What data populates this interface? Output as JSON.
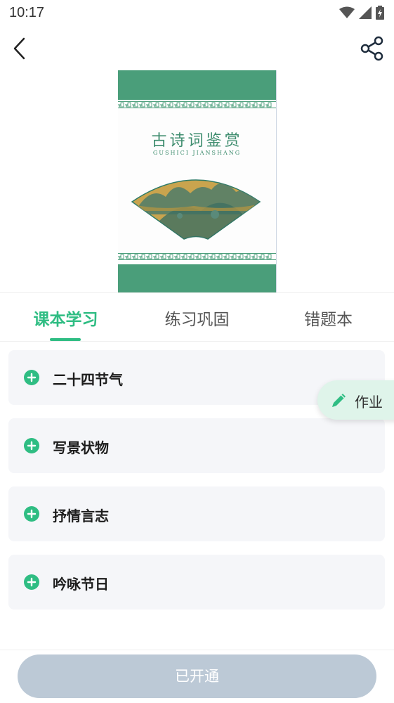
{
  "status_bar": {
    "time": "10:17"
  },
  "header": {
    "back_icon": "chevron-left-icon",
    "share_icon": "share-icon"
  },
  "cover": {
    "title": "古诗词鉴赏",
    "subtitle": "GUSHICI JIANSHANG",
    "band_color": "#4a9e7a"
  },
  "tabs": [
    {
      "label": "课本学习",
      "active": true
    },
    {
      "label": "练习巩固",
      "active": false
    },
    {
      "label": "错题本",
      "active": false
    }
  ],
  "accent_color": "#2fbd83",
  "units": [
    {
      "label": "二十四节气"
    },
    {
      "label": "写景状物"
    },
    {
      "label": "抒情言志"
    },
    {
      "label": "吟咏节日"
    }
  ],
  "homework_fab": {
    "label": "作业",
    "icon": "pencil-icon"
  },
  "bottom": {
    "button_label": "已开通"
  }
}
